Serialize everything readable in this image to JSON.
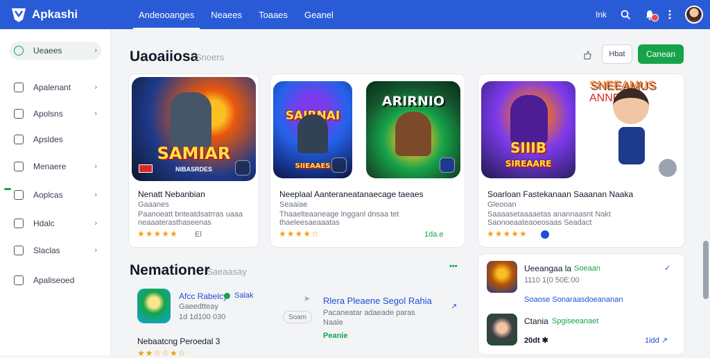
{
  "app": {
    "name": "Apkashi"
  },
  "nav": [
    {
      "label": "Andeooanges",
      "active": true
    },
    {
      "label": "Neaees",
      "active": false
    },
    {
      "label": "Toaaes",
      "active": false
    },
    {
      "label": "Geanel",
      "active": false
    }
  ],
  "topbar": {
    "lang": "Ink",
    "notifications_badge": true
  },
  "sidebar": [
    {
      "label": "Ueaees",
      "icon": "home-icon"
    },
    {
      "label": "Apalenant",
      "icon": "grid-icon"
    },
    {
      "label": "Apolsns",
      "icon": "folder-icon"
    },
    {
      "label": "Apsldes",
      "icon": "document-icon"
    },
    {
      "label": "Menaere",
      "icon": "image-icon"
    },
    {
      "label": "Aoplcas",
      "icon": "apps-icon"
    },
    {
      "label": "Hdalc",
      "icon": "heart-icon"
    },
    {
      "label": "Slaclas",
      "icon": "chat-icon"
    },
    {
      "label": "Apaliseoed",
      "icon": "settings-icon"
    }
  ],
  "section1": {
    "title": "Uaoaiiosa",
    "subtitle": "Snoers",
    "btn_outline": "Hbat",
    "btn_primary": "Canean"
  },
  "featured": [
    {
      "thumb_title": "SAMIAR",
      "thumb_sub": "NIBASRDES",
      "title": "Nenatt Nebanbian",
      "desc1": "Gaaanes",
      "desc2": "Paanoeatt bnteatdsatrras uaaa",
      "desc3": "neaaaterasthaseenas",
      "rating": "★★★★★",
      "meta": "El"
    },
    {
      "thumb_title": "SAIRNAI",
      "thumb_sub": "SIIEAAES",
      "title": "Neeplaal Aanteraneatanaecage taeaes",
      "desc1": "Seaaiae",
      "desc2": "Thaaelteaaneage lngganl dnsaa tet",
      "desc3": "thaeleesaeaaatas",
      "rating": "★★★★☆",
      "meta": "1da.e"
    },
    {
      "thumb_title": "ARIRNIO",
      "thumb_sub": "",
      "title": "",
      "desc1": "",
      "desc2": "",
      "desc3": "",
      "rating": "",
      "meta": ""
    },
    {
      "thumb_title": "SIIIB",
      "thumb_sub": "SIREAARE",
      "title": "Soarloan Fastekanaan Saaanan Naaka",
      "desc1": "Gleooan",
      "desc2": "Saaaasetaaaaetas anannaasnt Nakt",
      "desc3": "Saonoeaateaoeosaas Seadact",
      "rating": "★★★★★",
      "meta": ""
    },
    {
      "thumb_title": "SNEEAMUS",
      "thumb_sub": "ANNE",
      "title": "",
      "desc1": "",
      "desc2": "",
      "desc3": "",
      "rating": "",
      "meta": ""
    }
  ],
  "section2": {
    "title": "Nemationer",
    "subtitle": "Saeaasay",
    "more": "•••"
  },
  "list_left": [
    {
      "title": "Afcc Rabelcy",
      "tag": "Salak",
      "sub": "Gaeedtteay",
      "meta": "1d 1d100 030",
      "btn": "Soam"
    },
    {
      "title": "Rlera Pleaene Segol Rahia",
      "desc": "Pacaneatar adaeade paras",
      "desc2": "Naale",
      "link": "Peanie"
    }
  ],
  "list_left_footer": {
    "title": "Nebaatcng Peroedal 3",
    "rating": "★★☆☆★☆"
  },
  "list_right": [
    {
      "title": "Ueeangaa la",
      "tag": "Soeaan",
      "meta": "1110 1(0 50E:00",
      "desc": "Soaose Sonaraasdoeananan",
      "link": ""
    },
    {
      "title": "Ctania",
      "tag": "Spgiseeanaet",
      "meta": "20dt ✱",
      "desc": "",
      "link": "1idd ↗"
    }
  ]
}
